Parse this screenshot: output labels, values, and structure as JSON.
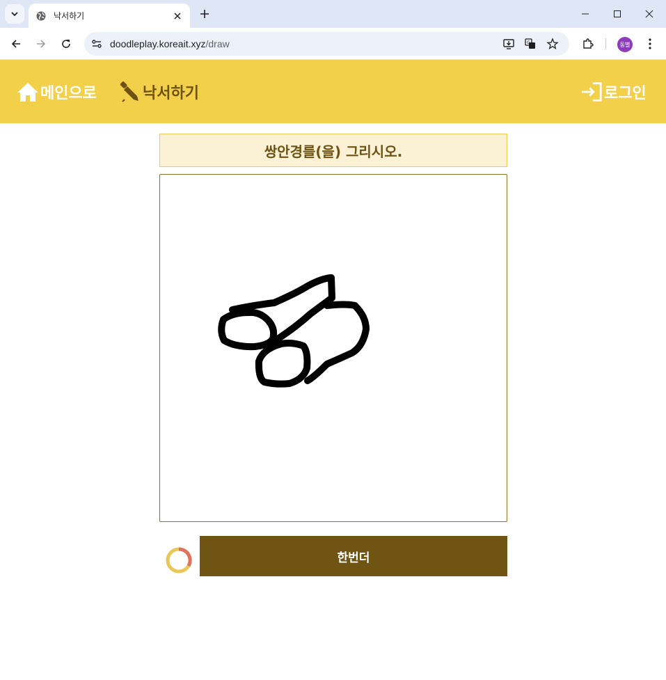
{
  "browser": {
    "tab_title": "낙서하기",
    "url_host": "doodleplay.koreait.xyz",
    "url_path": "/draw",
    "profile_initials": "동별"
  },
  "header": {
    "home_label": "메인으로",
    "draw_label": "낙서하기",
    "login_label": "로그인",
    "bg_color": "#f2d04a"
  },
  "main": {
    "prompt": "쌍안경를(을) 그리시오.",
    "retry_label": "한번더"
  }
}
